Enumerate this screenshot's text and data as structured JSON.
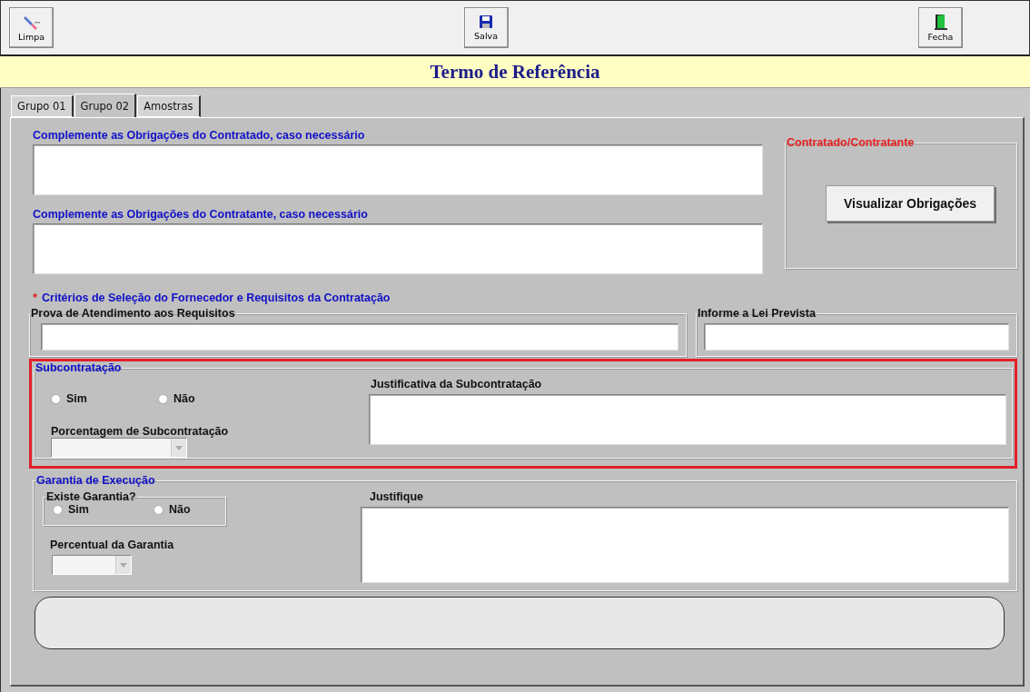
{
  "toolbar": [
    {
      "label": "Limpa",
      "kind": "eraser"
    },
    {
      "label": "Salva",
      "kind": "save"
    },
    {
      "label": "Fecha",
      "kind": "door"
    }
  ],
  "title": "Termo de Referência",
  "tabs": [
    {
      "label": "Grupo 01",
      "selected": false
    },
    {
      "label": "Grupo 02",
      "selected": true
    },
    {
      "label": "Amostras",
      "selected": false
    }
  ],
  "obrigacoes": [
    {
      "label": "Complemente as Obrigações do Contratado, caso necessário"
    },
    {
      "label": "Complemente as Obrigações do Contratante, caso necessário"
    }
  ],
  "contratado_group": {
    "legend": "Contratado/Contratante",
    "button": "Visualizar Obrigações"
  },
  "criterios": {
    "marker": "*",
    "title": "Critérios de Seleção do Fornecedor e Requisitos da Contratação"
  },
  "prova": {
    "legend": "Prova de Atendimento aos Requisitos"
  },
  "lei": {
    "legend": "Informe a Lei Prevista"
  },
  "subcontratacao": {
    "legend": "Subcontratação",
    "options": [
      {
        "label": "Sim",
        "selected": false
      },
      {
        "label": "Não",
        "selected": false
      }
    ],
    "percent_label": "Porcentagem de Subcontratação",
    "justification_label": "Justificativa da Subcontratação"
  },
  "garantia": {
    "legend": "Garantia de Execução",
    "question": "Existe Garantia?",
    "options": [
      {
        "label": "Sim",
        "selected": false
      },
      {
        "label": "Não",
        "selected": false
      }
    ],
    "percent_label": "Percentual da Garantia",
    "justification_label": "Justifique"
  }
}
